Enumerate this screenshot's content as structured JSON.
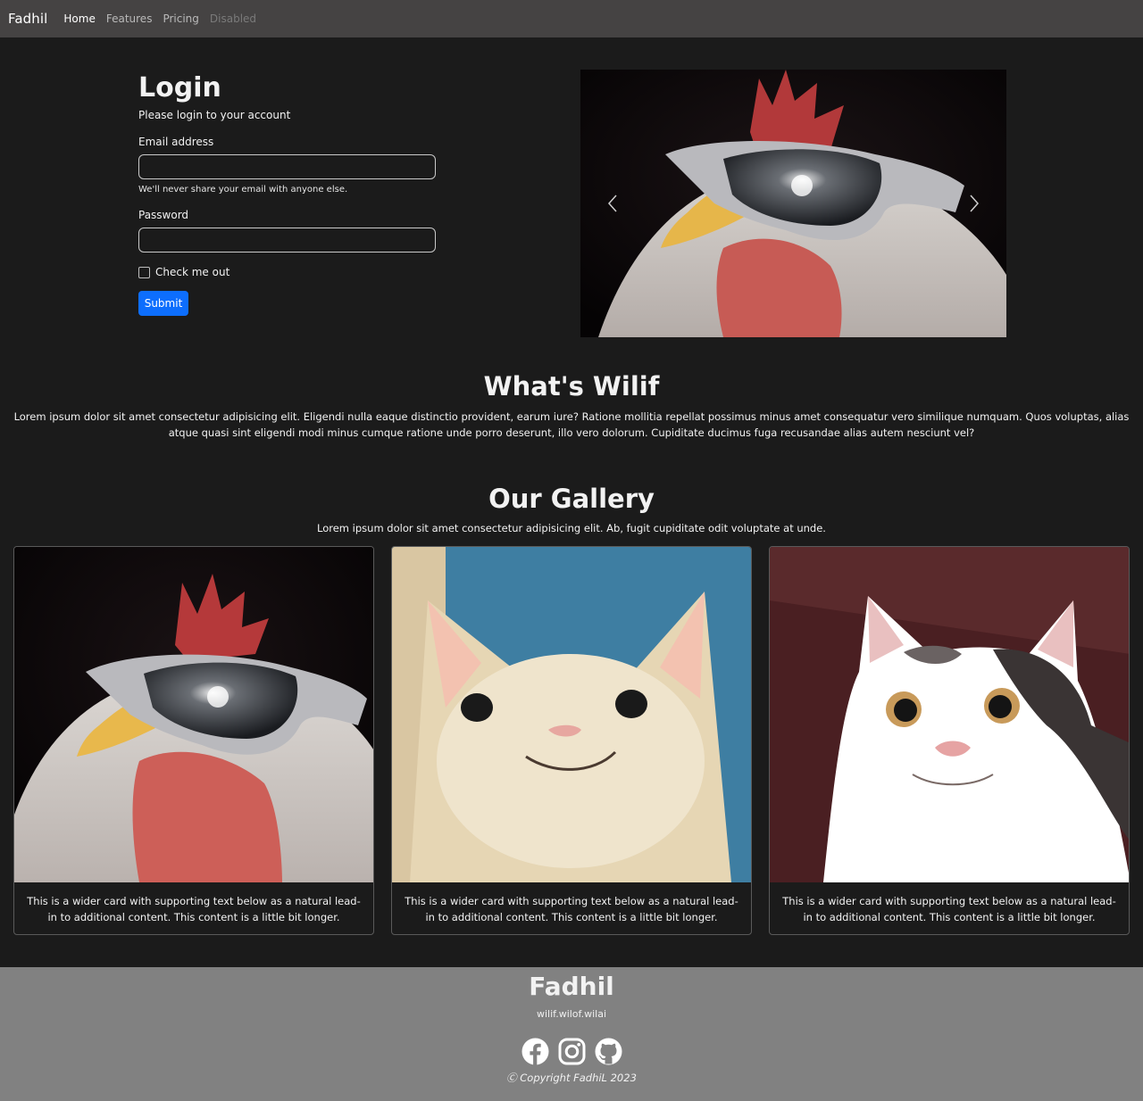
{
  "navbar": {
    "brand": "Fadhil",
    "links": [
      {
        "label": "Home",
        "state": "active"
      },
      {
        "label": "Features",
        "state": "normal"
      },
      {
        "label": "Pricing",
        "state": "normal"
      },
      {
        "label": "Disabled",
        "state": "disabled"
      }
    ]
  },
  "login": {
    "title": "Login",
    "subtitle": "Please login to your account",
    "email_label": "Email address",
    "email_value": "",
    "email_help": "We'll never share your email with anyone else.",
    "password_label": "Password",
    "password_value": "",
    "checkbox_label": "Check me out",
    "checkbox_checked": false,
    "submit_label": "Submit"
  },
  "carousel": {
    "image": "rooster-with-sunglasses",
    "prev_icon": "chevron-left-icon",
    "next_icon": "chevron-right-icon"
  },
  "about": {
    "title": "What's Wilif",
    "text": "Lorem ipsum dolor sit amet consectetur adipisicing elit. Eligendi nulla eaque distinctio provident, earum iure? Ratione mollitia repellat possimus minus amet consequatur vero similique numquam. Quos voluptas, alias atque quasi sint eligendi modi minus cumque ratione unde porro deserunt, illo vero dolorum. Cupiditate ducimus fuga recusandae alias autem nesciunt vel?"
  },
  "gallery": {
    "title": "Our Gallery",
    "subtitle": "Lorem ipsum dolor sit amet consectetur adipisicing elit. Ab, fugit cupiditate odit voluptate at unde.",
    "cards": [
      {
        "image": "rooster-with-sunglasses",
        "text": "This is a wider card with supporting text below as a natural lead-in to additional content. This content is a little bit longer."
      },
      {
        "image": "smiling-white-cat",
        "text": "This is a wider card with supporting text below as a natural lead-in to additional content. This content is a little bit longer."
      },
      {
        "image": "polite-cat",
        "text": "This is a wider card with supporting text below as a natural lead-in to additional content. This content is a little bit longer."
      }
    ]
  },
  "footer": {
    "brand": "Fadhil",
    "domain": "wilif.wilof.wilai",
    "socials": [
      "facebook-icon",
      "instagram-icon",
      "github-icon"
    ],
    "copyright": "Ⓒ Copyright FadhiL 2023"
  },
  "colors": {
    "page_bg": "#1b1b1b",
    "navbar_bg": "#454343",
    "footer_bg": "#818181",
    "primary": "#0d6efd"
  }
}
